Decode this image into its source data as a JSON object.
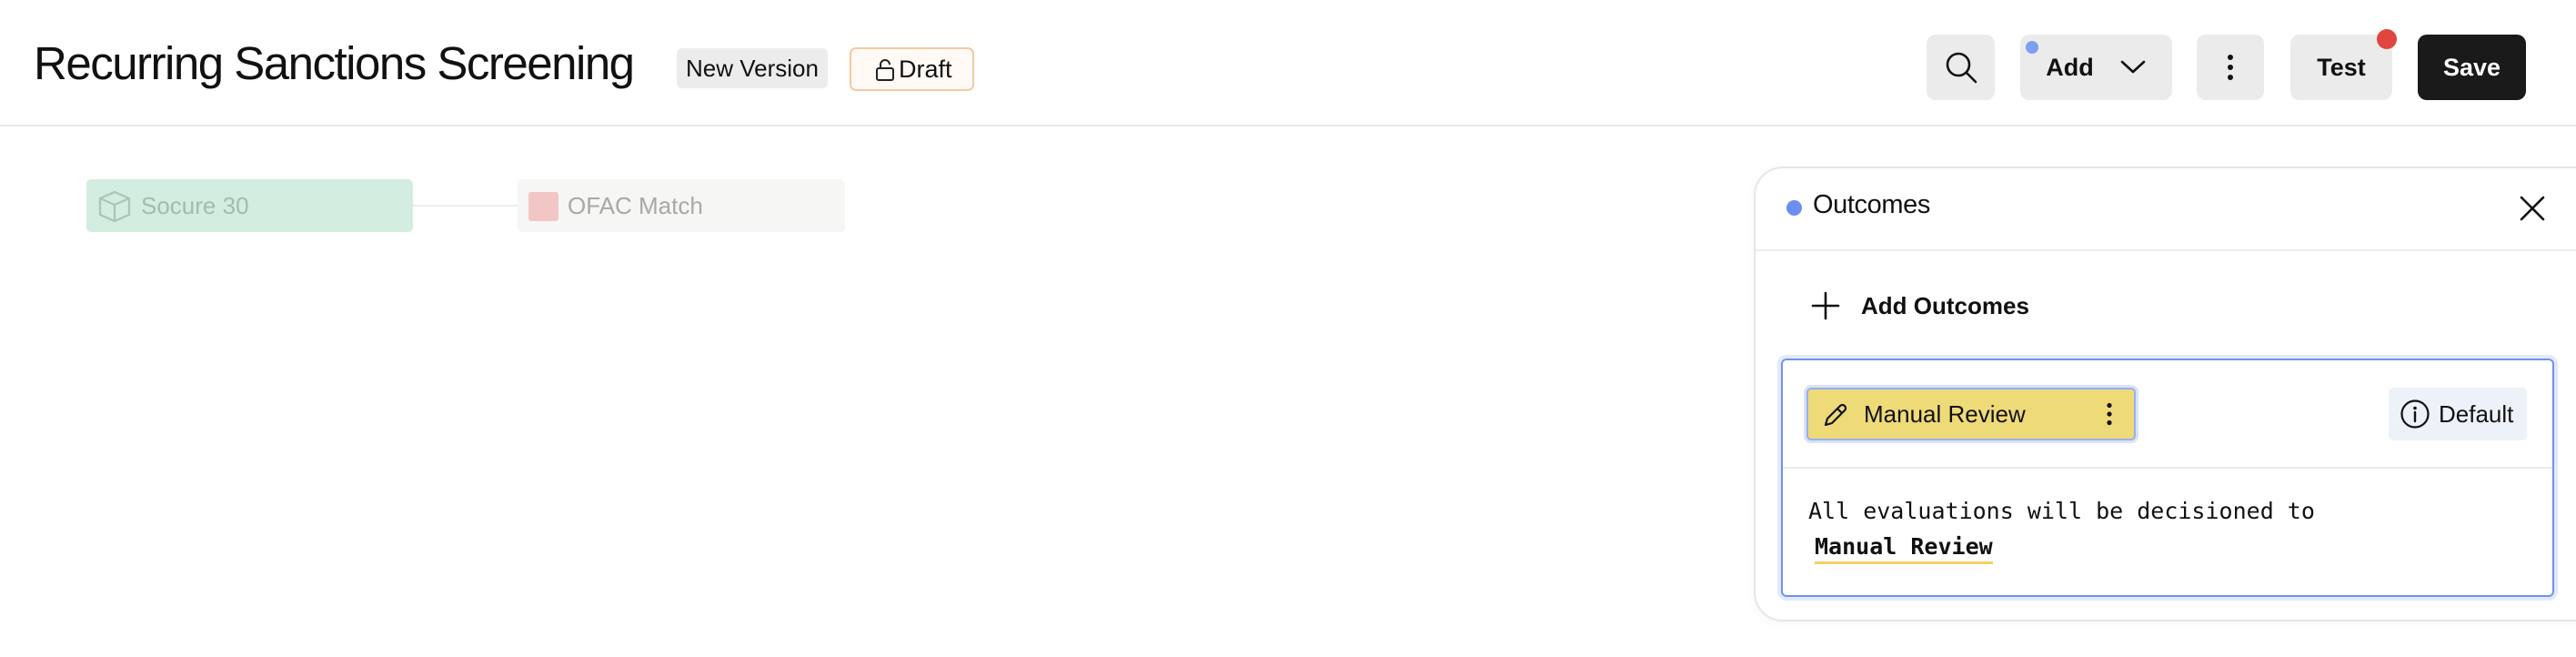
{
  "header": {
    "title": "Recurring Sanctions Screening",
    "version_badge": "New Version",
    "status_badge": "Draft",
    "search_icon": "search-icon",
    "add_label": "Add",
    "test_label": "Test",
    "save_label": "Save"
  },
  "canvas": {
    "nodes": [
      {
        "label": "Socure 30",
        "icon": "cube-icon"
      },
      {
        "label": "OFAC Match",
        "icon": "square-icon"
      }
    ]
  },
  "panel": {
    "title": "Outcomes",
    "add_label": "Add Outcomes",
    "outcome": {
      "name": "Manual Review",
      "default_label": "Default",
      "description": "All evaluations will be decisioned to",
      "value": "Manual Review"
    }
  },
  "colors": {
    "accent_blue": "#6f93ea",
    "outcome_yellow": "#efda78",
    "save_black": "#1a1a1a",
    "notification_red": "#e0463f",
    "node_green": "#d3ede0",
    "node_red": "#f3c6c6"
  }
}
